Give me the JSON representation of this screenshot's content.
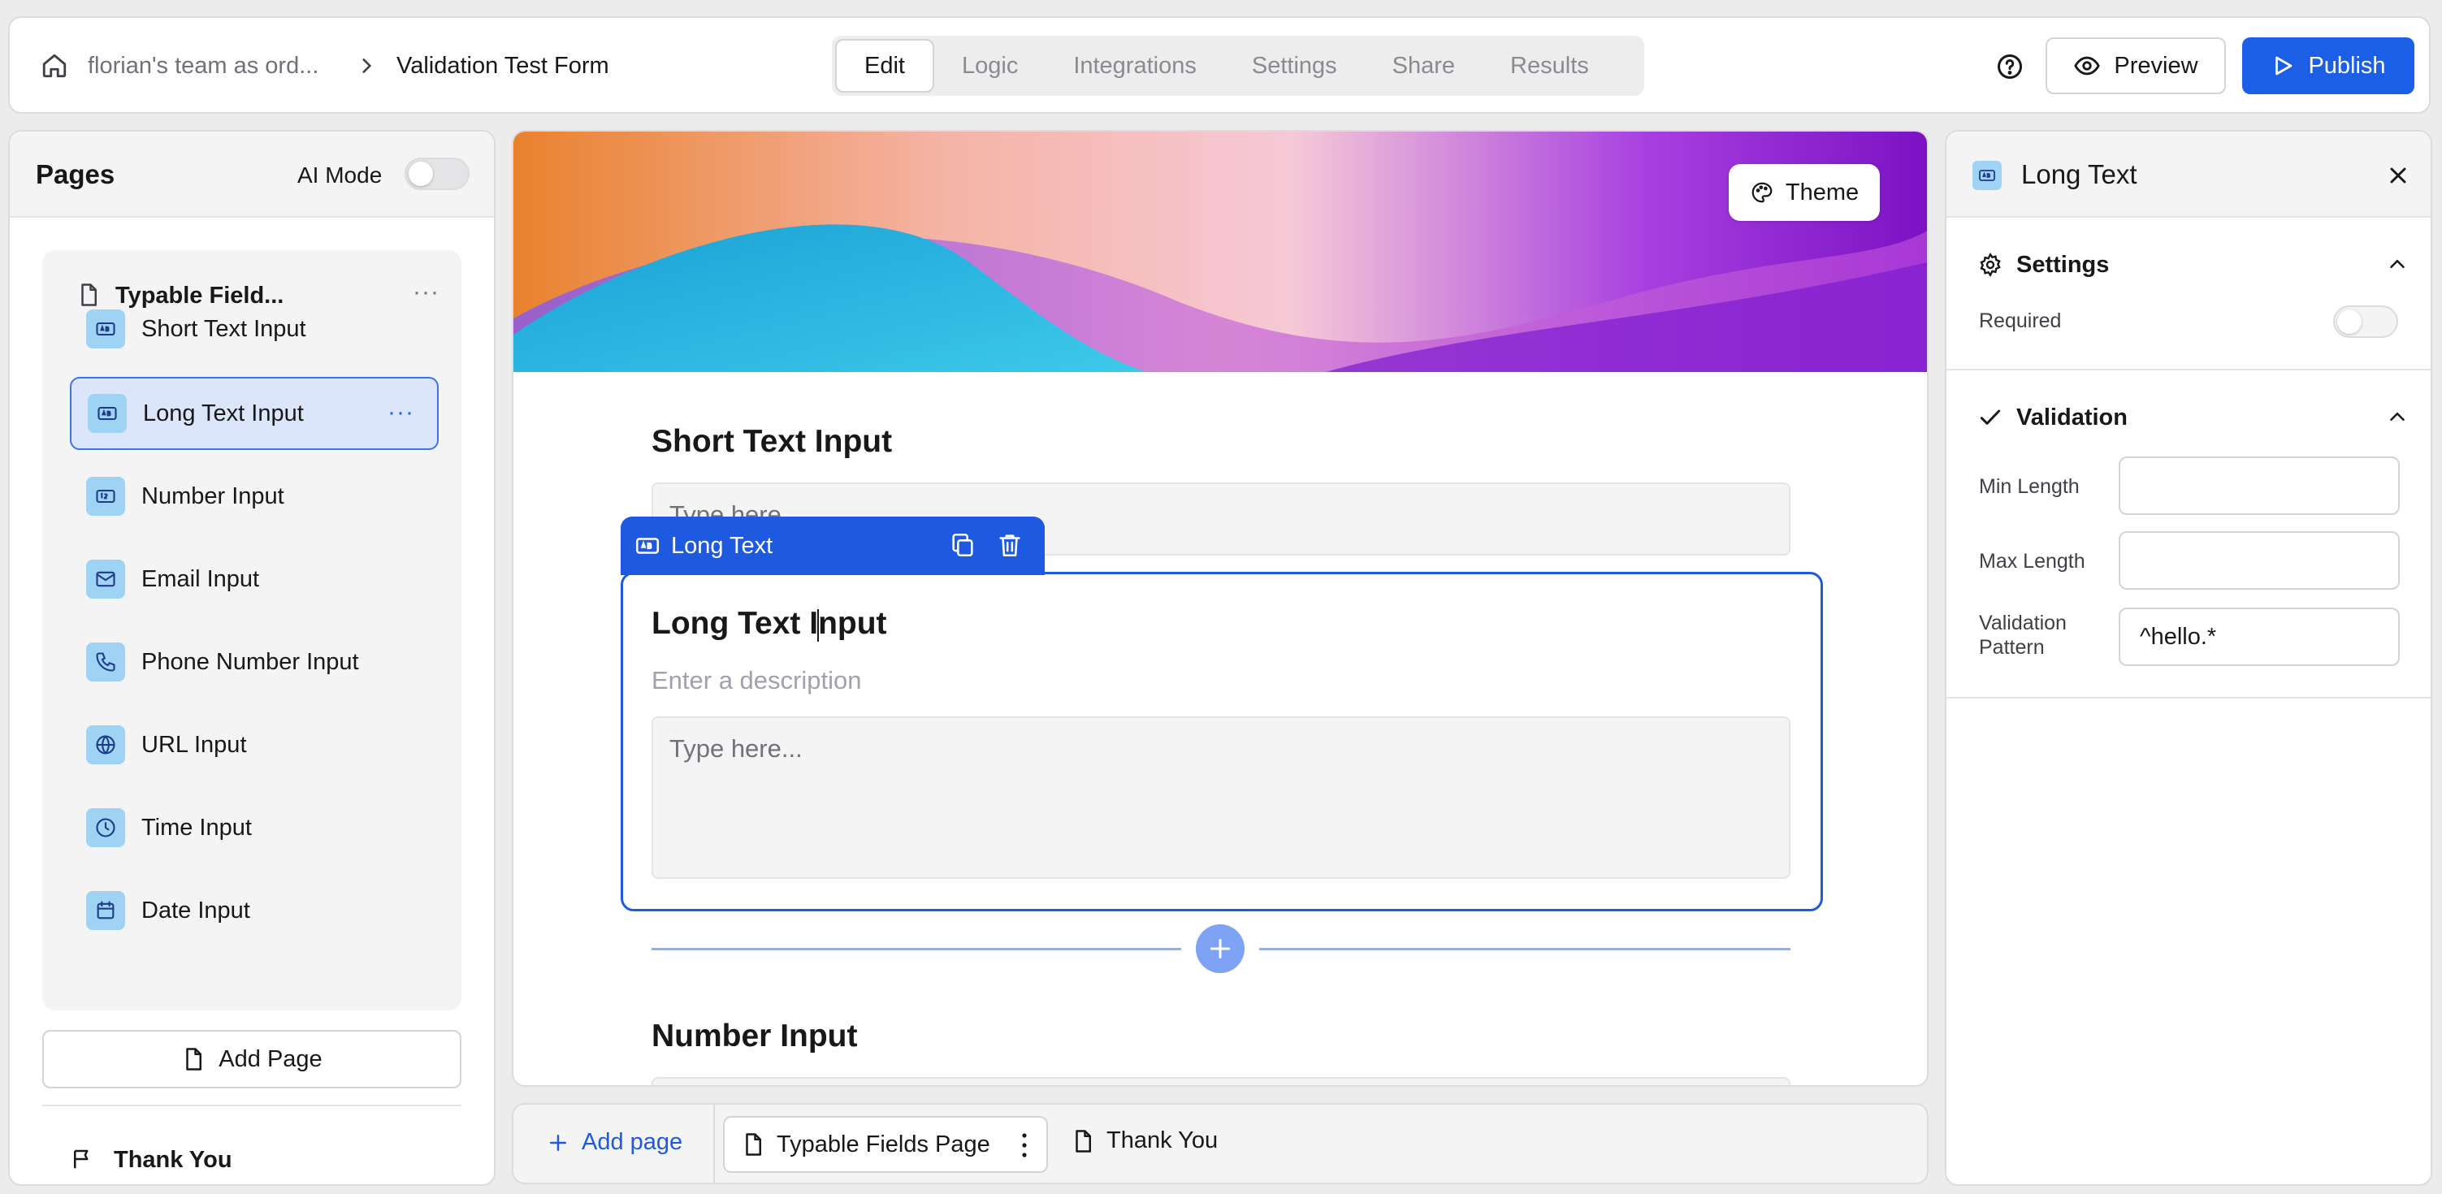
{
  "header": {
    "team": "florian's team as ord...",
    "form_title": "Validation Test Form",
    "tabs": [
      "Edit",
      "Logic",
      "Integrations",
      "Settings",
      "Share",
      "Results"
    ],
    "active_tab": "Edit",
    "preview_label": "Preview",
    "publish_label": "Publish",
    "accent_color": "#1a5fe6"
  },
  "left_panel": {
    "title": "Pages",
    "ai_mode_label": "AI Mode",
    "ai_mode_on": false,
    "page_group": {
      "title": "Typable Field...",
      "fields": [
        {
          "label": "Short Text Input",
          "icon": "text-field-icon"
        },
        {
          "label": "Long Text Input",
          "icon": "text-field-icon",
          "selected": true
        },
        {
          "label": "Number Input",
          "icon": "number-icon"
        },
        {
          "label": "Email Input",
          "icon": "mail-icon"
        },
        {
          "label": "Phone Number Input",
          "icon": "phone-icon"
        },
        {
          "label": "URL Input",
          "icon": "globe-link-icon"
        },
        {
          "label": "Time Input",
          "icon": "clock-icon"
        },
        {
          "label": "Date Input",
          "icon": "calendar-icon"
        }
      ]
    },
    "add_page_label": "Add Page",
    "thank_you_label": "Thank You"
  },
  "canvas": {
    "theme_label": "Theme",
    "short_text": {
      "title": "Short Text Input",
      "placeholder": "Type here..."
    },
    "selected_block": {
      "tab_label": "Long Text",
      "title_before_caret": "Long Text I",
      "title_after_caret": "nput",
      "description_placeholder": "Enter a description",
      "placeholder": "Type here..."
    },
    "number": {
      "title": "Number Input"
    }
  },
  "bottom_bar": {
    "add_page_label": "Add page",
    "pages": [
      {
        "label": "Typable Fields Page",
        "active": true
      },
      {
        "label": "Thank You",
        "active": false
      }
    ]
  },
  "right_panel": {
    "title": "Long Text",
    "settings": {
      "title": "Settings",
      "required_label": "Required",
      "required_on": false
    },
    "validation": {
      "title": "Validation",
      "min_length_label": "Min Length",
      "min_length_value": "",
      "max_length_label": "Max Length",
      "max_length_value": "",
      "pattern_label_line1": "Validation",
      "pattern_label_line2": "Pattern",
      "pattern_value": "^hello.*"
    }
  }
}
